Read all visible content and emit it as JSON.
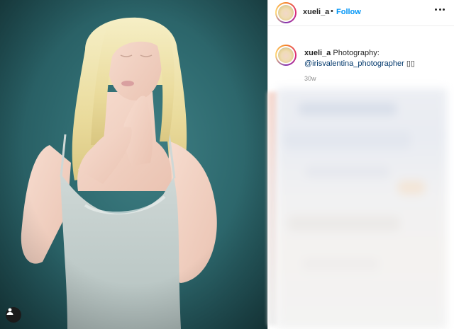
{
  "post": {
    "author": {
      "username": "xueli_a",
      "separator": "•",
      "follow_label": "Follow"
    },
    "caption": {
      "username": "xueli_a",
      "text": "Photography:",
      "mention": "@irisvalentina_photographer",
      "emoji": "▯▯",
      "timestamp": "30w"
    },
    "icons": {
      "more": "more-options-icon",
      "tag": "user-tag-icon"
    },
    "colors": {
      "accent": "#0095f6",
      "mention": "#00376b",
      "photo_background": "#2f6b70"
    }
  }
}
